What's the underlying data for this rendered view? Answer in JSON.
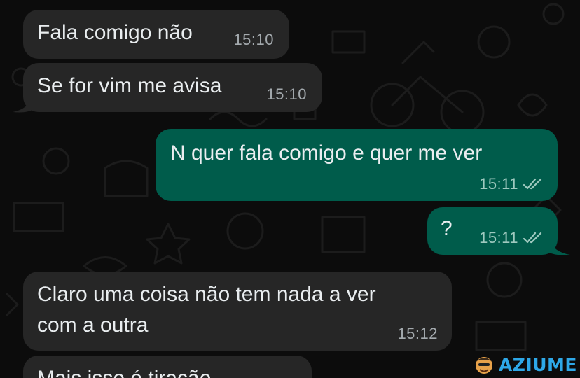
{
  "theme": {
    "background": "#0c0c0c",
    "incoming_bubble": "#262626",
    "outgoing_bubble": "#005c4b",
    "text": "#e9edef",
    "timestamp": "#a4aaae",
    "read_ticks": "#9fc9bf",
    "watermark": "#2ea8e8"
  },
  "messages": [
    {
      "direction": "incoming",
      "text": "Fala comigo não",
      "time": "15:10"
    },
    {
      "direction": "incoming",
      "text": "Se for vim me avisa",
      "time": "15:10"
    },
    {
      "direction": "outgoing",
      "text": "N quer fala comigo e quer me ver",
      "time": "15:11",
      "status_icon": "double-check-icon"
    },
    {
      "direction": "outgoing",
      "text": "?",
      "time": "15:11",
      "status_icon": "double-check-icon"
    },
    {
      "direction": "incoming",
      "text_lines": [
        "Claro uma coisa não tem nada a ver",
        "com a outra"
      ],
      "time": "15:12"
    },
    {
      "direction": "incoming",
      "text": "Mais isso é tiração",
      "partially_visible": true
    }
  ],
  "watermark": {
    "text": "AZIUME",
    "icon": "mascot-logo-icon"
  }
}
